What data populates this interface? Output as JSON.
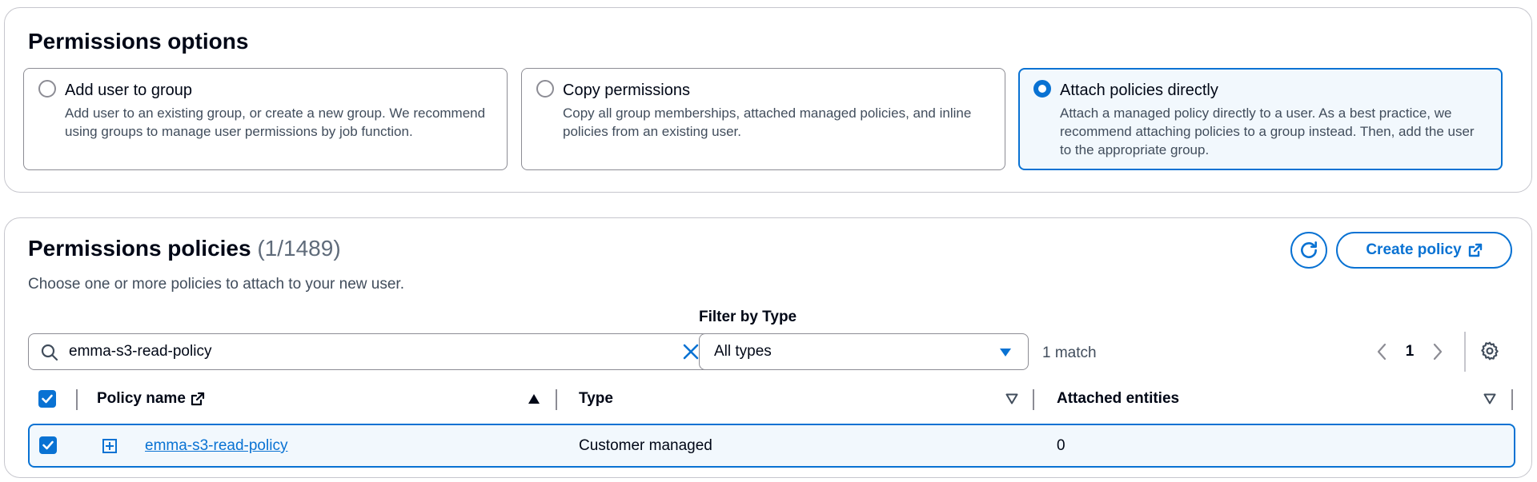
{
  "permissions_options": {
    "heading": "Permissions options",
    "options": [
      {
        "title": "Add user to group",
        "description": "Add user to an existing group, or create a new group. We recommend using groups to manage user permissions by job function.",
        "selected": false
      },
      {
        "title": "Copy permissions",
        "description": "Copy all group memberships, attached managed policies, and inline policies from an existing user.",
        "selected": false
      },
      {
        "title": "Attach policies directly",
        "description": "Attach a managed policy directly to a user. As a best practice, we recommend attaching policies to a group instead. Then, add the user to the appropriate group.",
        "selected": true
      }
    ]
  },
  "permissions_policies": {
    "heading": "Permissions policies",
    "count": "(1/1489)",
    "description": "Choose one or more policies to attach to your new user.",
    "create_policy_label": "Create policy",
    "refresh_icon": "refresh-icon",
    "external_link_icon": "external-link-icon"
  },
  "filters": {
    "search_value": "emma-s3-read-policy",
    "filter_label": "Filter by Type",
    "type_selected": "All types",
    "match_count": "1 match"
  },
  "pagination": {
    "current_page": "1"
  },
  "table": {
    "columns": [
      "Policy name",
      "Type",
      "Attached entities"
    ],
    "rows": [
      {
        "policy_name": "emma-s3-read-policy",
        "type": "Customer managed",
        "attached_entities": "0",
        "checked": true
      }
    ]
  },
  "colors": {
    "accent": "#0972d3",
    "selected_bg": "#f2f8fd",
    "border": "#8c8c94",
    "text": "#000716",
    "secondary_text": "#414d5c"
  }
}
